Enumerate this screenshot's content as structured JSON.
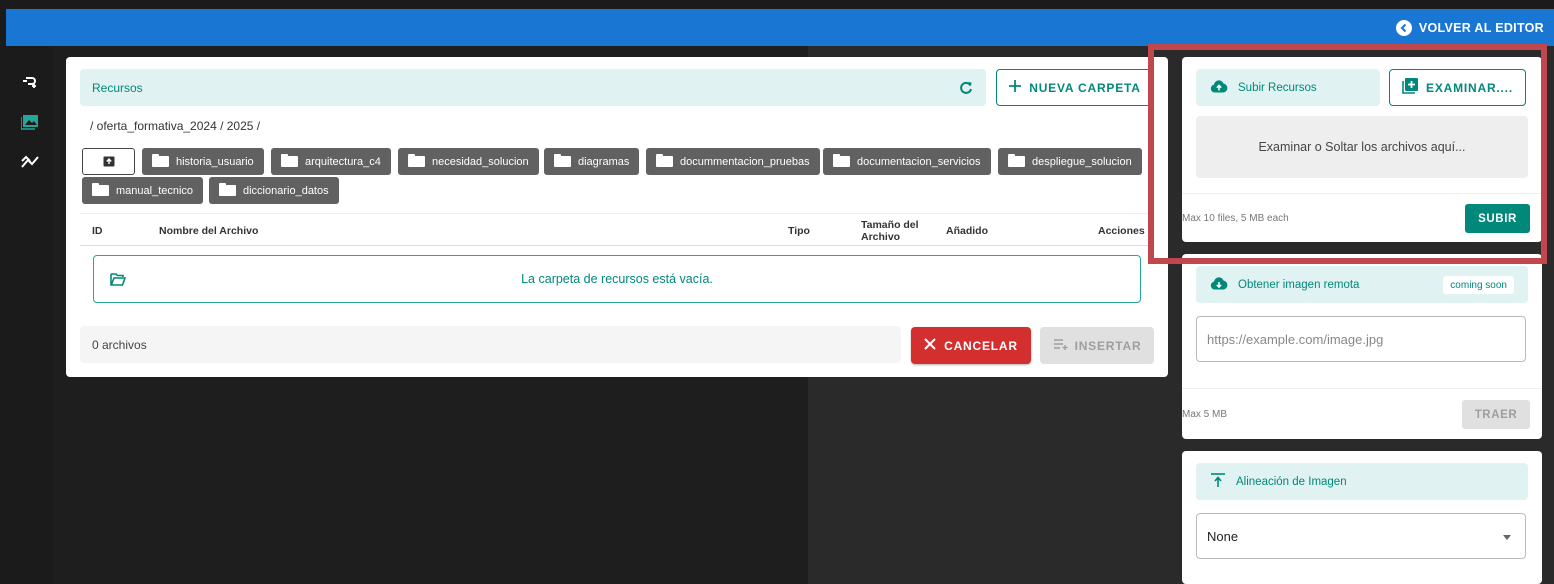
{
  "topbar": {
    "back_label": "VOLVER AL EDITOR"
  },
  "resources": {
    "title": "Recursos",
    "new_folder_label": "NUEVA CARPETA",
    "breadcrumb": "/ oferta_formativa_2024 / 2025 /",
    "folders": [
      "historia_usuario",
      "arquitectura_c4",
      "necesidad_solucion",
      "diagramas",
      "docummentacion_pruebas",
      "documentacion_servicios",
      "despliegue_solucion",
      "manual_tecnico",
      "diccionario_datos"
    ],
    "columns": {
      "id": "ID",
      "name": "Nombre del Archivo",
      "type": "Tipo",
      "size": "Tamaño del Archivo",
      "added": "Añadido",
      "actions": "Acciones"
    },
    "empty_message": "La carpeta de recursos está vacía.",
    "file_count": "0 archivos",
    "cancel_label": "CANCELAR",
    "insert_label": "INSERTAR"
  },
  "upload": {
    "title": "Subir Recursos",
    "browse_label": "EXAMINAR....",
    "dropzone_text": "Examinar o Soltar los archivos aquí...",
    "limits": "Max 10 files, 5 MB each",
    "submit_label": "SUBIR"
  },
  "remote": {
    "title": "Obtener imagen remota",
    "badge": "coming soon",
    "placeholder": "https://example.com/image.jpg",
    "limits": "Max 5 MB",
    "fetch_label": "TRAER"
  },
  "alignment": {
    "title": "Alineación de Imagen",
    "selected": "None"
  },
  "colors": {
    "accent": "#00897b",
    "primary": "#1976d2",
    "danger": "#d32f2f",
    "highlight": "#c0474d"
  }
}
